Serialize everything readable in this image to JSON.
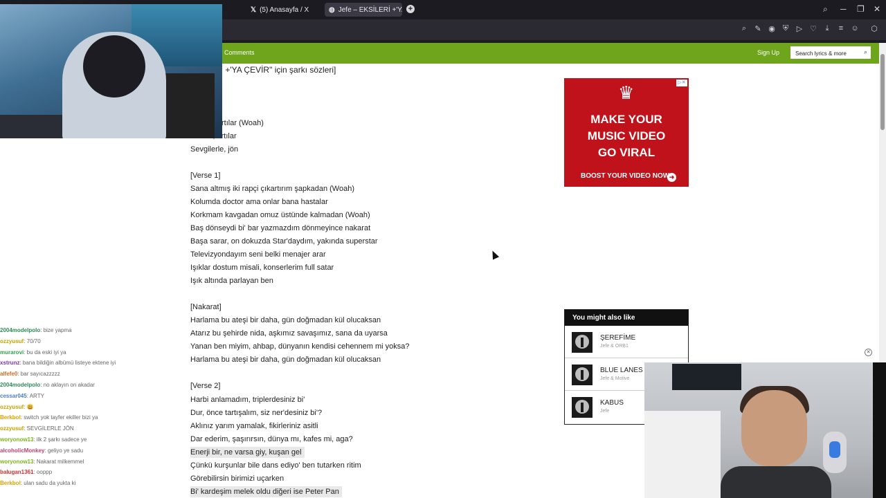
{
  "browser": {
    "tabs": [
      {
        "icon": "x-logo-icon",
        "label": "(5) Anasayfa / X"
      },
      {
        "icon": "genius-icon",
        "label": "Jefe – EKSİLERİ +'YA ÇEVİR"
      }
    ],
    "new_tab_label": "+"
  },
  "site": {
    "nav_comments": "Comments",
    "sign_up": "Sign Up",
    "search_placeholder": "Search lyrics & more",
    "accent_color": "#6fa51c"
  },
  "lyrics": {
    "title_fragment": "Rİ +'YA ÇEVİR\" için şarkı sözleri]",
    "lines": [
      "rtılar (Woah)",
      "Eksiler, artılar",
      "Sevgilerle, jön",
      "[Verse 1]",
      "Sana altmış iki rapçi çıkartırım şapkadan (Woah)",
      "Kolumda doctor ama onlar bana hastalar",
      "Korkmam kavgadan omuz üstünde kalmadan (Woah)",
      "Baş dönseydi bi' bar yazmazdım dönmeyince nakarat",
      "Başa sarar, on dokuzda Star'daydım, yakında superstar",
      "Televizyondayım seni belki menajer arar",
      "Işıklar dostum misali, konserlerim full satar",
      "Işık altında parlayan ben",
      "[Nakarat]",
      "Harlama bu ateşi bir daha, gün doğmadan kül olucaksan",
      "Atarız bu şehirde nida, aşkımız savaşımız, sana da uyarsa",
      "Yanan ben miyim, ahbap, dünyanın kendisi cehennem mi yoksa?",
      "Harlama bu ateşi bir daha, gün doğmadan kül olucaksan",
      "[Verse 2]",
      "Harbi anlamadım, triplerdesiniz bi'",
      "Dur, önce tartışalım, siz ner'desiniz bi'?",
      "Aklınız yarım yamalak, fikirleriniz asitli",
      "Dar ederim, şaşırırsın, dünya mı, kafes mi, aga?",
      "Enerji bir, ne varsa giy, kuşan gel",
      "Çünkü kurşunlar bile dans ediyo' ben tutarken ritim",
      "Görebilirsin birimizi uçarken",
      "Bi' kardeşim melek oldu diğeri ise Peter Pan"
    ]
  },
  "ad": {
    "headline": "MAKE YOUR\nMUSIC VIDEO\nGO VIRAL",
    "cta": "BOOST YOUR VIDEO NOW",
    "bg_color": "#c0121a"
  },
  "related": {
    "header": "You might also like",
    "items": [
      {
        "title": "ŞEREFİME",
        "artist": "Jefe & ORB1"
      },
      {
        "title": "BLUE LANES",
        "artist": "Jefe & Motive"
      },
      {
        "title": "KABUS",
        "artist": "Jefe"
      }
    ]
  },
  "chat": {
    "messages": [
      {
        "user": "2004modelpolo",
        "text": ": bize yapma",
        "color": "#2e8b57"
      },
      {
        "user": "ozzyusuf",
        "text": ": 70/70",
        "color": "#c8a000"
      },
      {
        "user": "murarovi",
        "text": ": bu da eski iyi ya",
        "color": "#2ea44f"
      },
      {
        "user": "xstrunz",
        "text": ": bana bildiğin albümü listeye ektene iyi",
        "color": "#7b2fbf"
      },
      {
        "user": "alfefe0",
        "text": ": bar sayıcazzzzz",
        "color": "#d2691e"
      },
      {
        "user": "2004modelpolo",
        "text": ": no aklayın on akadar",
        "color": "#2e8b57"
      },
      {
        "user": "cessar045",
        "text": ": ARTY",
        "color": "#4a7bd0"
      },
      {
        "user": "ozzyusuf",
        "text": ": 😃",
        "color": "#c8a000"
      },
      {
        "user": "Berkbol",
        "text": ": switch yok tayfer ekiller bizi ya",
        "color": "#e0a000"
      },
      {
        "user": "ozzyusuf",
        "text": ": SEVGİLERLE JÖN",
        "color": "#c8a000"
      },
      {
        "user": "woryonow13",
        "text": ": ilk 2 şarkı sadece ye",
        "color": "#7bb61c"
      },
      {
        "user": "alcoholicMonkey",
        "text": ": geliyo ye sadu",
        "color": "#c04070"
      },
      {
        "user": "woryonow13",
        "text": ": Nakarat milkemmel",
        "color": "#7bb61c"
      },
      {
        "user": "balugan1361",
        "text": ": ooppp",
        "color": "#d03030"
      },
      {
        "user": "Berkbol",
        "text": ": ulan sadu da yukta ki",
        "color": "#e0a000"
      }
    ]
  }
}
